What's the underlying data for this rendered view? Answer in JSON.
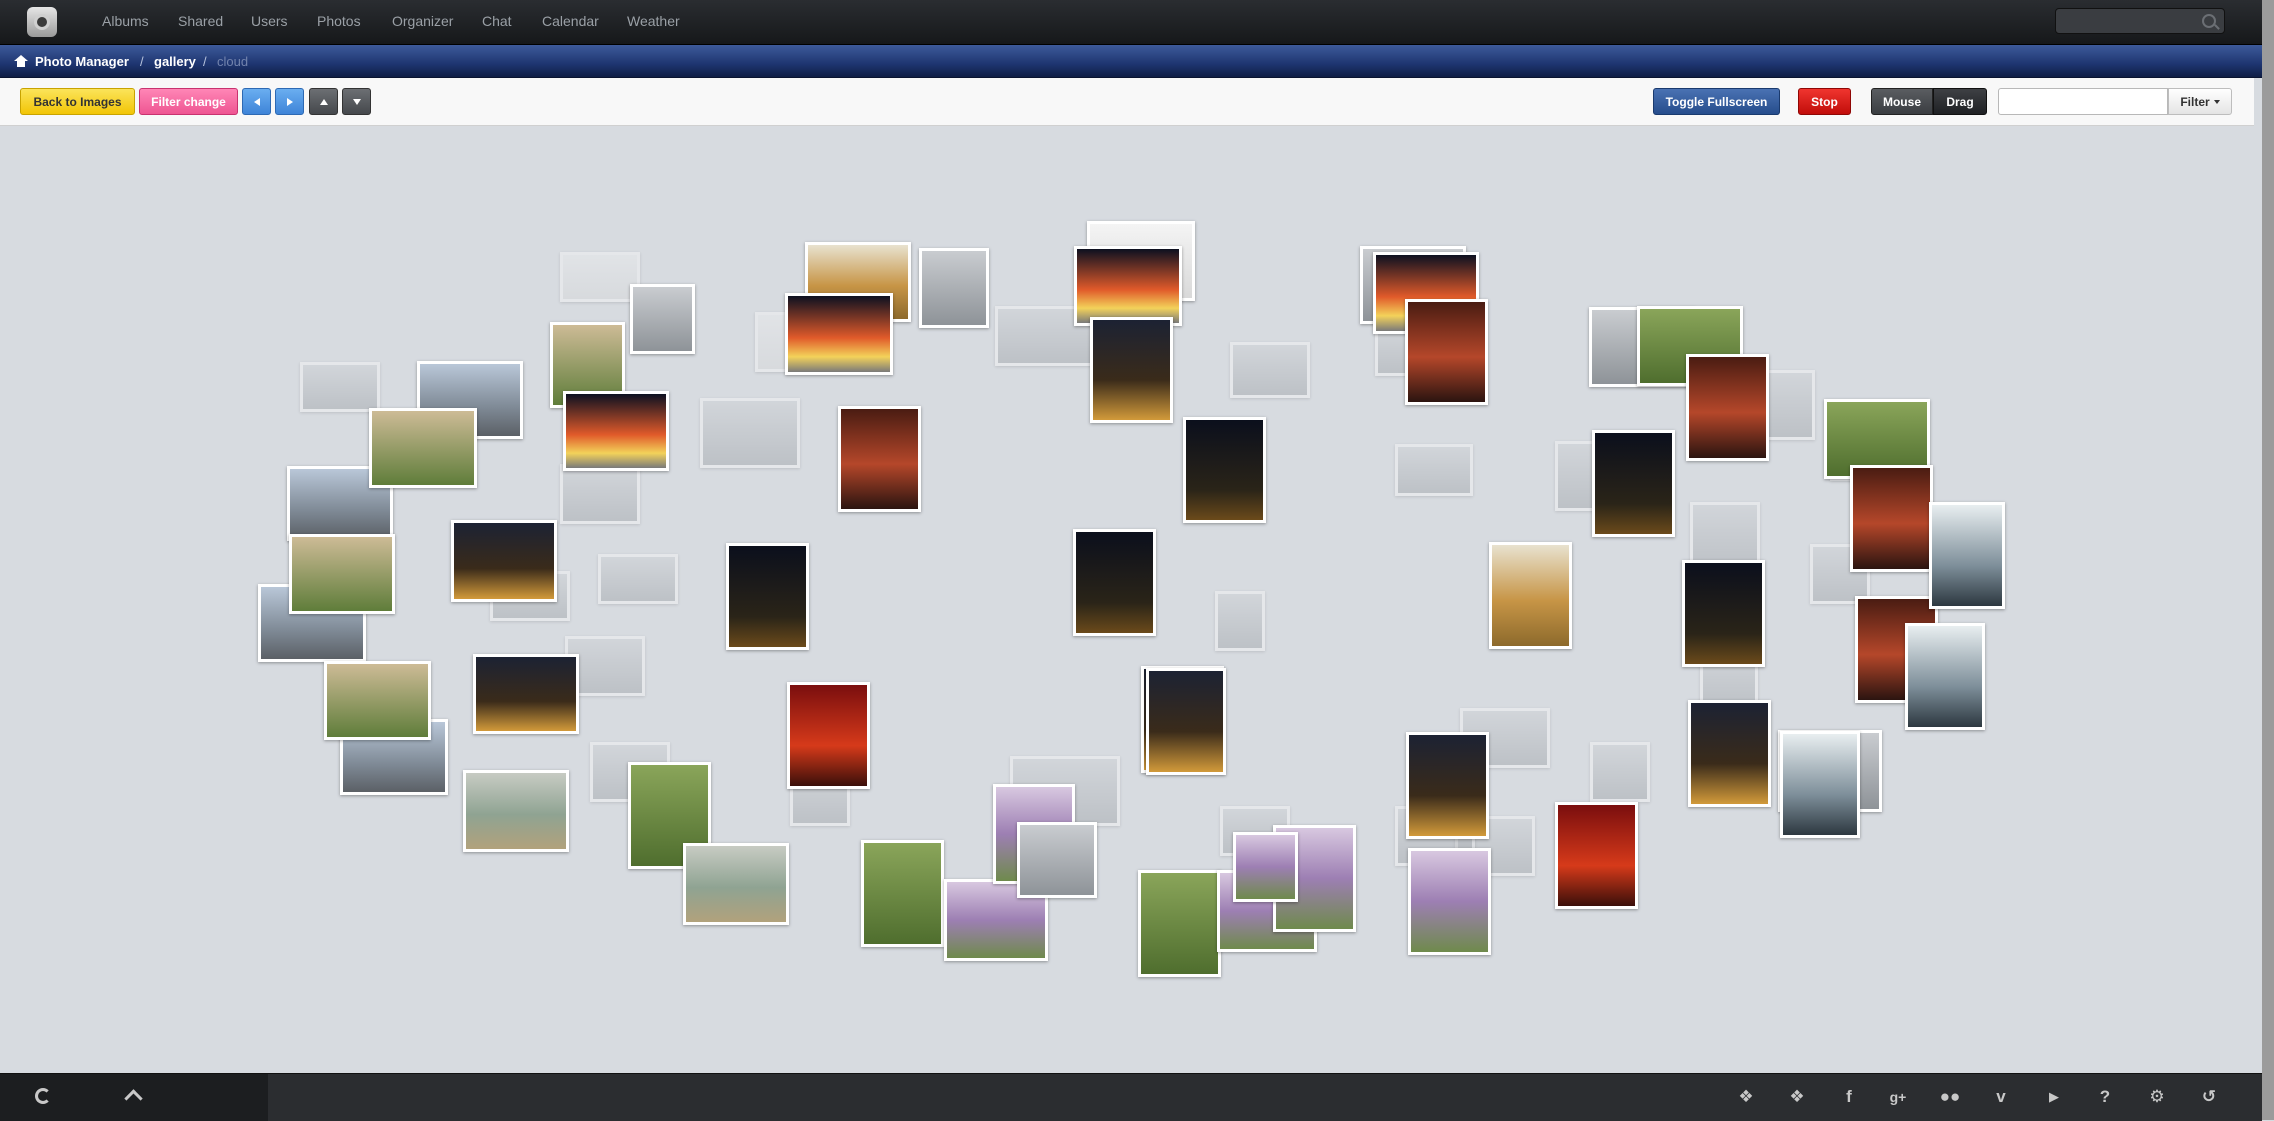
{
  "nav": {
    "items": [
      "Albums",
      "Shared",
      "Users",
      "Photos",
      "Organizer",
      "Chat",
      "Calendar",
      "Weather"
    ]
  },
  "breadcrumb": {
    "root": "Photo Manager",
    "section": "gallery",
    "current": "cloud",
    "separator": "/"
  },
  "toolbar": {
    "back_label": "Back to Images",
    "filter_change_label": "Filter change",
    "toggle_fullscreen_label": "Toggle Fullscreen",
    "stop_label": "Stop",
    "mouse_label": "Mouse",
    "drag_label": "Drag",
    "filter_label": "Filter",
    "filter_value": ""
  },
  "colors": {
    "navbar": "#1d1f22",
    "breadcrumb": "#1e3570",
    "gallery_bg": "#d7dbe0"
  },
  "footer": {
    "left_icons": [
      "refresh-icon",
      "chevron-up-icon"
    ],
    "right_icons": [
      "dropbox-icon",
      "twitter-icon",
      "facebook-icon",
      "google-plus-icon",
      "flickr-icon",
      "vimeo-icon",
      "youtube-icon",
      "help-icon",
      "settings-icon",
      "logout-icon"
    ]
  }
}
